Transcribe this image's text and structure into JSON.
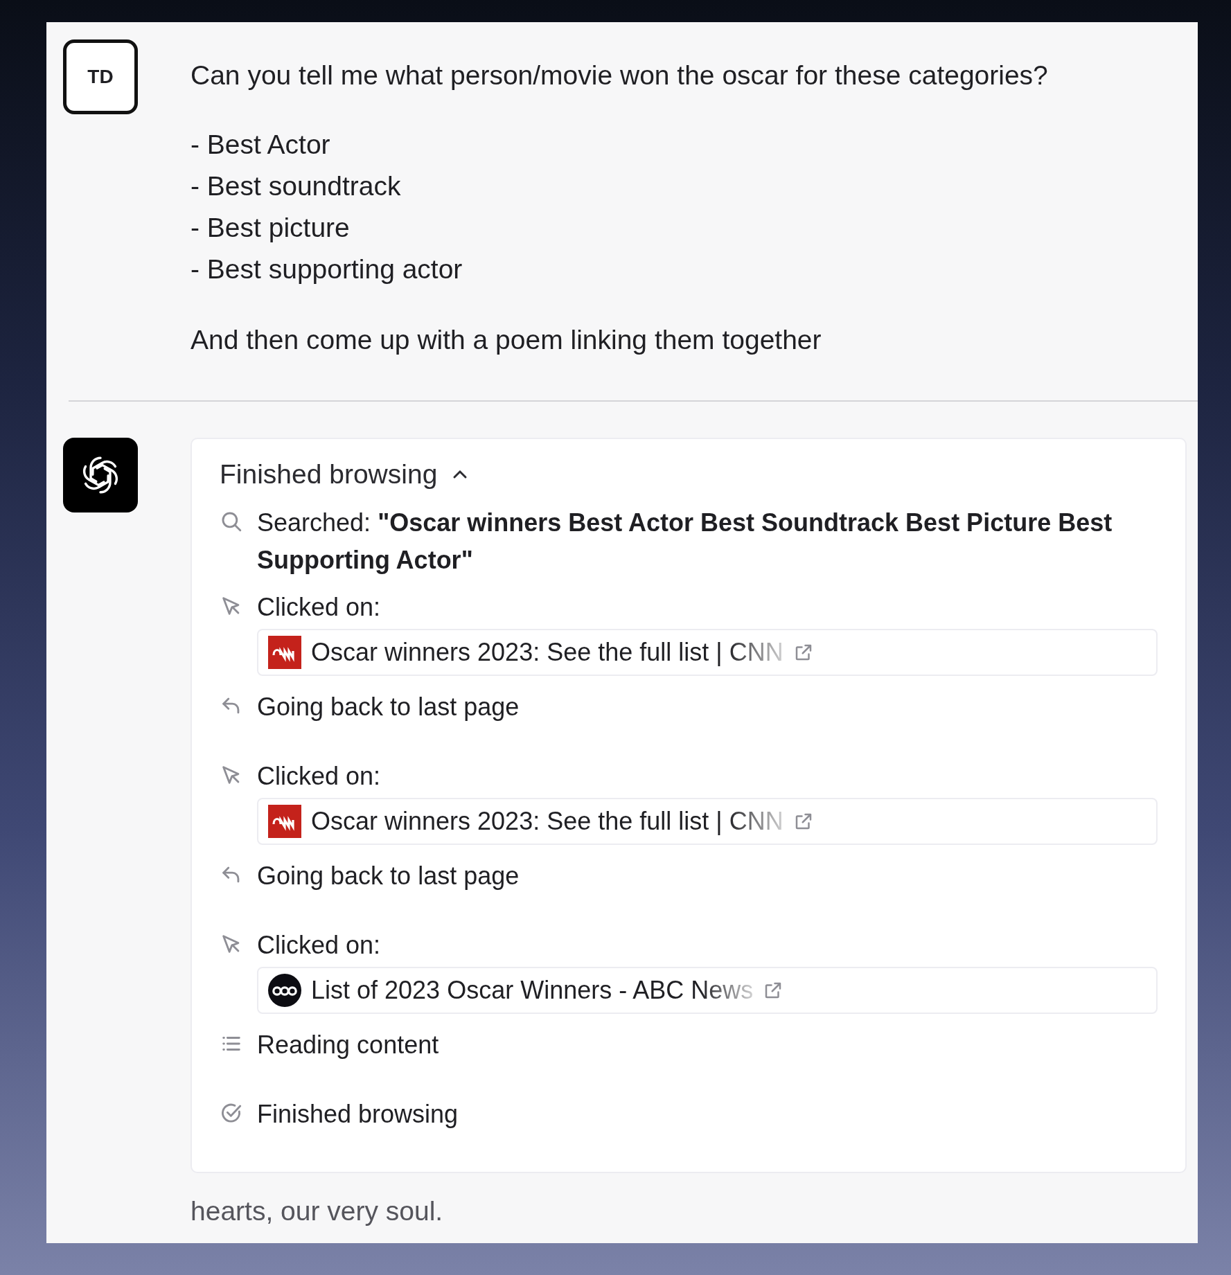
{
  "user": {
    "avatar": "TD",
    "question": "Can you tell me what person/movie won the oscar for these categories?",
    "list": [
      "- Best Actor",
      "- Best soundtrack",
      "- Best picture",
      "- Best supporting actor"
    ],
    "closing": "And then come up with a poem linking them together"
  },
  "browsing": {
    "title": "Finished browsing",
    "expanded": true,
    "steps": [
      {
        "kind": "search",
        "text": "Searched: **\"Oscar winners Best Actor Best Soundtrack Best Picture Best Supporting Actor\"**"
      },
      {
        "kind": "click",
        "text": "Clicked on:",
        "link": {
          "kind": "cnn",
          "title": "Oscar winners 2023: See the full list | CNN"
        }
      },
      {
        "kind": "back",
        "text": "Going back to last page"
      },
      {
        "kind": "click",
        "text": "Clicked on:",
        "link": {
          "kind": "cnn",
          "title": "Oscar winners 2023: See the full list | CNN"
        }
      },
      {
        "kind": "back",
        "text": "Going back to last page"
      },
      {
        "kind": "click",
        "text": "Clicked on:",
        "link": {
          "kind": "abc",
          "title": "List of 2023 Oscar Winners - ABC News"
        }
      },
      {
        "kind": "read",
        "text": "Reading content"
      },
      {
        "kind": "done",
        "text": "Finished browsing"
      }
    ]
  },
  "poem": [
    "hearts, our very soul."
  ]
}
